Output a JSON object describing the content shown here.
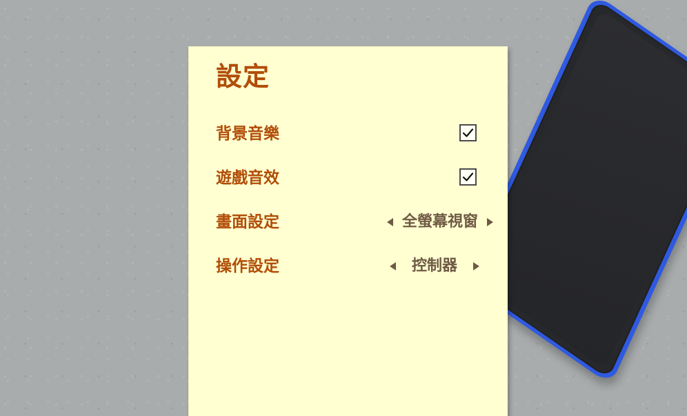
{
  "settings": {
    "title": "設定",
    "rows": [
      {
        "label": "背景音樂",
        "control": "checkbox",
        "checked": true
      },
      {
        "label": "遊戲音效",
        "control": "checkbox",
        "checked": true
      },
      {
        "label": "畫面設定",
        "control": "selector",
        "value": "全螢幕視窗"
      },
      {
        "label": "操作設定",
        "control": "selector",
        "value": "控制器"
      }
    ]
  },
  "colors": {
    "background": "#a9acad",
    "panel": "#ffffd1",
    "title_label": "#b14d08",
    "selector_text": "#6f5a45",
    "device_border": "#2f5ae0",
    "device_screen": "#27282c"
  },
  "icons": {
    "checkbox_checked": "check-icon",
    "selector_left": "left-triangle-icon",
    "selector_right": "right-triangle-icon"
  }
}
